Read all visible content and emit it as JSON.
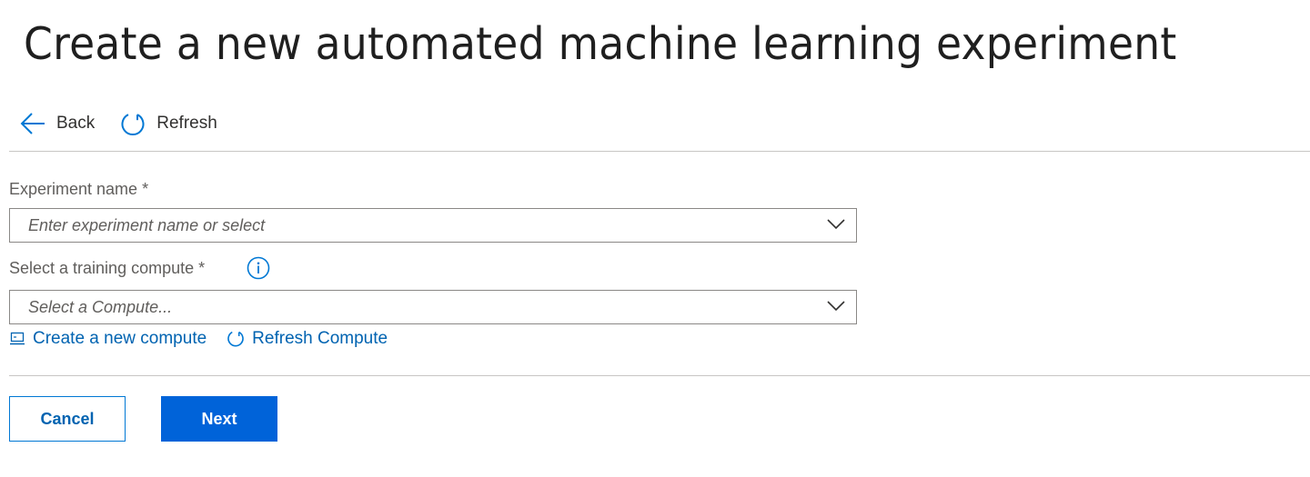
{
  "page": {
    "title": "Create a new automated machine learning experiment"
  },
  "toolbar": {
    "back_label": "Back",
    "refresh_label": "Refresh"
  },
  "form": {
    "experiment": {
      "label": "Experiment name *",
      "placeholder": "Enter experiment name or select",
      "value": ""
    },
    "compute": {
      "label": "Select a training compute *",
      "placeholder": "Select a Compute...",
      "value": ""
    },
    "links": {
      "create_compute": "Create a new compute",
      "refresh_compute": "Refresh Compute"
    }
  },
  "actions": {
    "cancel_label": "Cancel",
    "next_label": "Next"
  },
  "colors": {
    "accent": "#0078d4",
    "primary_button": "#0063d9",
    "link": "#0063b1",
    "border": "#8a8886",
    "divider": "#c8c6c4"
  },
  "icons": {
    "back": "back-arrow-icon",
    "refresh": "refresh-icon",
    "chevron": "chevron-down-icon",
    "info": "info-icon",
    "compute": "compute-icon"
  }
}
